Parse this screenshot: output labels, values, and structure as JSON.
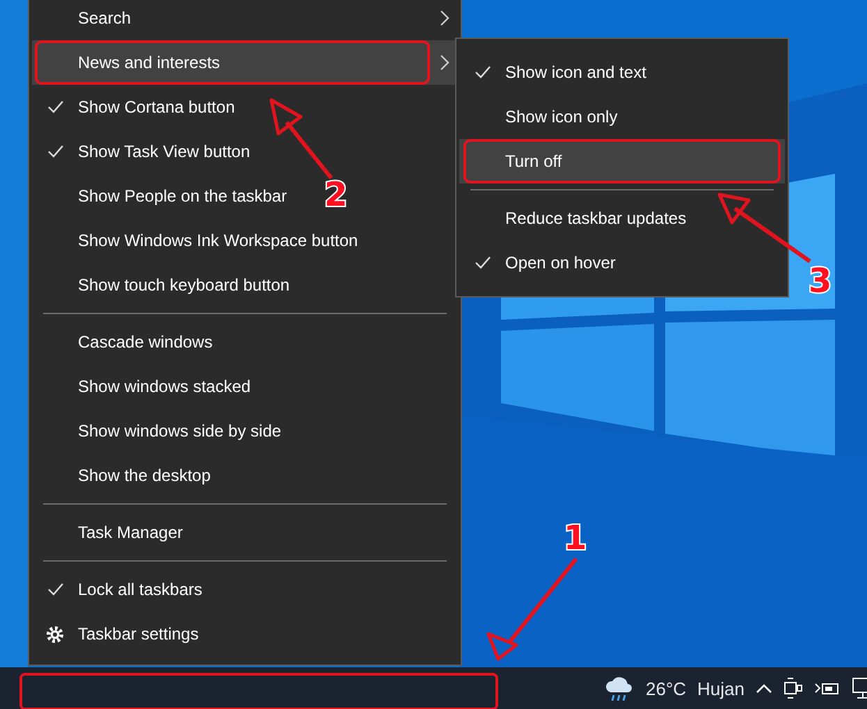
{
  "context_menu": {
    "items": [
      {
        "kind": "submenu",
        "label": "Search",
        "checked": false,
        "selected": false,
        "marked": false
      },
      {
        "kind": "submenu",
        "label": "News and interests",
        "checked": false,
        "selected": true,
        "marked": true
      },
      {
        "kind": "item",
        "label": "Show Cortana button",
        "checked": true,
        "selected": false,
        "marked": false
      },
      {
        "kind": "item",
        "label": "Show Task View button",
        "checked": true,
        "selected": false,
        "marked": false
      },
      {
        "kind": "item",
        "label": "Show People on the taskbar",
        "checked": false,
        "selected": false,
        "marked": false
      },
      {
        "kind": "item",
        "label": "Show Windows Ink Workspace button",
        "checked": false,
        "selected": false,
        "marked": false
      },
      {
        "kind": "item",
        "label": "Show touch keyboard button",
        "checked": false,
        "selected": false,
        "marked": false
      },
      {
        "kind": "separator"
      },
      {
        "kind": "item",
        "label": "Cascade windows",
        "checked": false,
        "selected": false,
        "marked": false
      },
      {
        "kind": "item",
        "label": "Show windows stacked",
        "checked": false,
        "selected": false,
        "marked": false
      },
      {
        "kind": "item",
        "label": "Show windows side by side",
        "checked": false,
        "selected": false,
        "marked": false
      },
      {
        "kind": "item",
        "label": "Show the desktop",
        "checked": false,
        "selected": false,
        "marked": false
      },
      {
        "kind": "separator"
      },
      {
        "kind": "item",
        "label": "Task Manager",
        "checked": false,
        "selected": false,
        "marked": false
      },
      {
        "kind": "separator"
      },
      {
        "kind": "item",
        "label": "Lock all taskbars",
        "checked": true,
        "selected": false,
        "marked": false
      },
      {
        "kind": "settings",
        "label": "Taskbar settings",
        "checked": false,
        "selected": false,
        "marked": false
      }
    ]
  },
  "submenu": {
    "items": [
      {
        "kind": "item",
        "label": "Show icon and text",
        "checked": true,
        "selected": false,
        "marked": false
      },
      {
        "kind": "item",
        "label": "Show icon only",
        "checked": false,
        "selected": false,
        "marked": false
      },
      {
        "kind": "item",
        "label": "Turn off",
        "checked": false,
        "selected": true,
        "marked": true
      },
      {
        "kind": "separator"
      },
      {
        "kind": "item",
        "label": "Reduce taskbar updates",
        "checked": false,
        "selected": false,
        "marked": false
      },
      {
        "kind": "item",
        "label": "Open on hover",
        "checked": true,
        "selected": false,
        "marked": false
      }
    ]
  },
  "taskbar": {
    "weather": {
      "temperature": "26°C",
      "condition": "Hujan"
    }
  },
  "annotations": [
    {
      "label": "1"
    },
    {
      "label": "2"
    },
    {
      "label": "3"
    }
  ]
}
